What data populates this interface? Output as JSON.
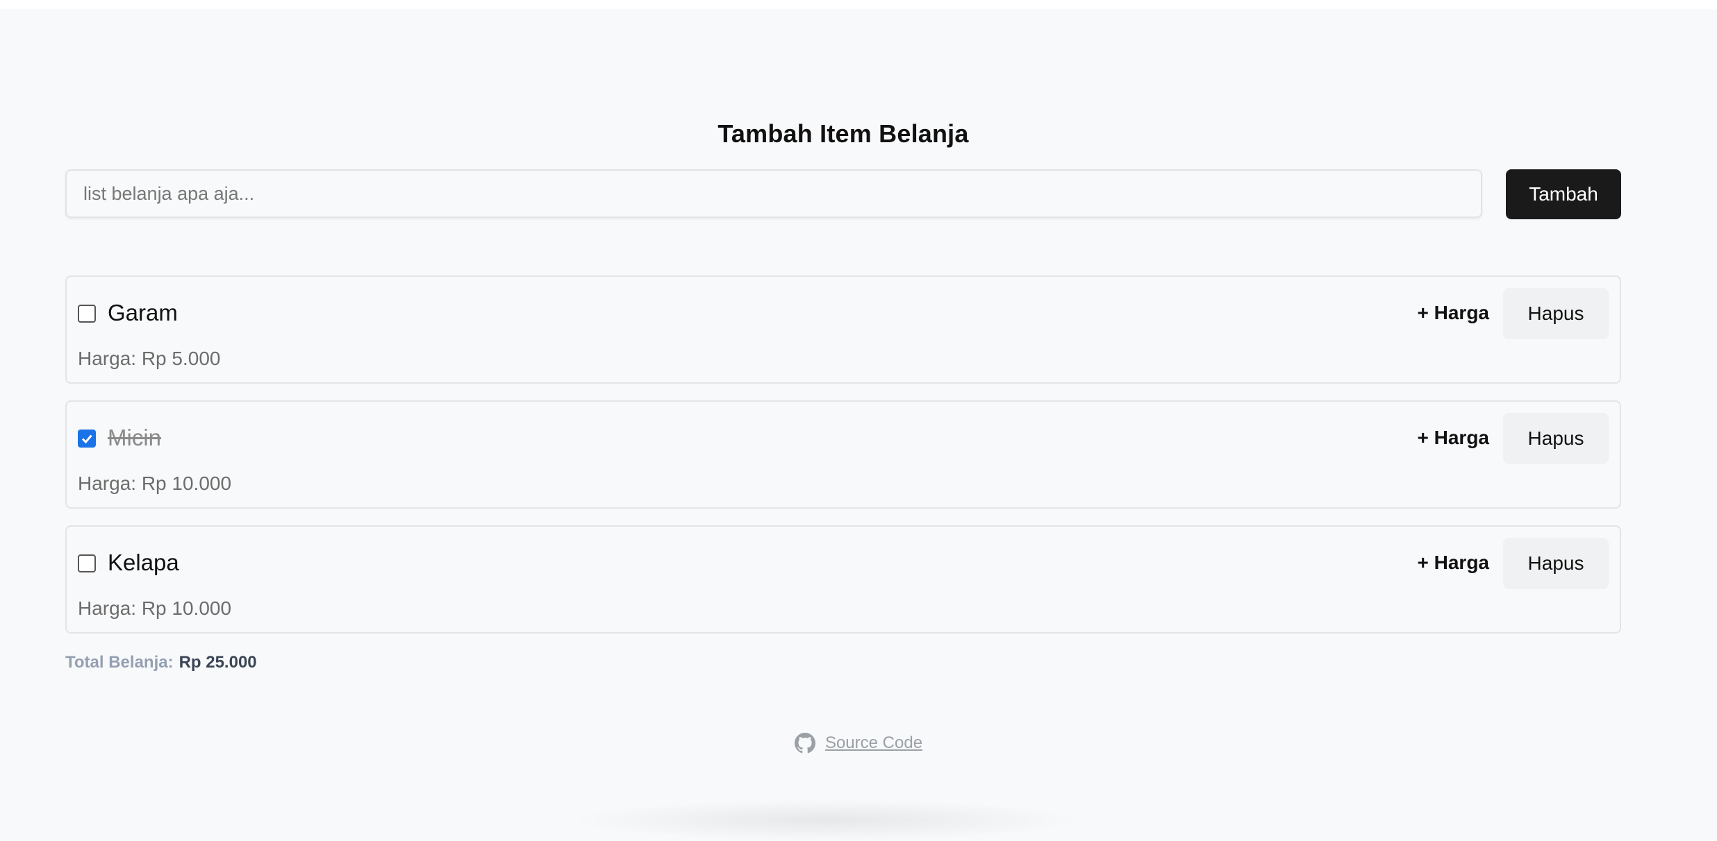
{
  "header": {
    "title": "Tambah Item Belanja"
  },
  "form": {
    "input_value": "",
    "input_placeholder": "list belanja apa aja...",
    "add_label": "Tambah"
  },
  "items": [
    {
      "name": "Garam",
      "checked": false,
      "price_label": "Harga: Rp 5.000",
      "add_price_label": "+ Harga",
      "delete_label": "Hapus"
    },
    {
      "name": "Micin",
      "checked": true,
      "price_label": "Harga: Rp 10.000",
      "add_price_label": "+ Harga",
      "delete_label": "Hapus"
    },
    {
      "name": "Kelapa",
      "checked": false,
      "price_label": "Harga: Rp 10.000",
      "add_price_label": "+ Harga",
      "delete_label": "Hapus"
    }
  ],
  "total": {
    "label": "Total Belanja:",
    "value": "Rp 25.000"
  },
  "footer": {
    "link_label": "Source Code",
    "icon": "github-icon"
  },
  "colors": {
    "background": "#f8f9fa",
    "primary_button": "#1a1a1a",
    "checkbox_accent": "#1a73e8"
  }
}
